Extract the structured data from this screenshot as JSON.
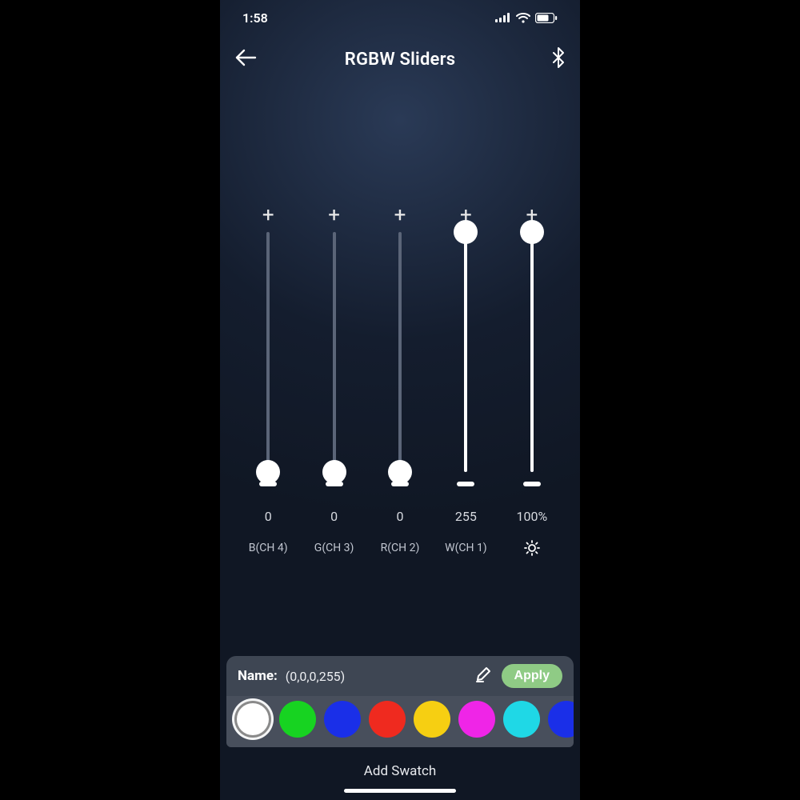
{
  "status": {
    "time": "1:58"
  },
  "header": {
    "title": "RGBW Sliders"
  },
  "sliders": [
    {
      "value": "0",
      "label": "B(CH 4)",
      "max": 255,
      "num": 0,
      "kind": "channel"
    },
    {
      "value": "0",
      "label": "G(CH 3)",
      "max": 255,
      "num": 0,
      "kind": "channel"
    },
    {
      "value": "0",
      "label": "R(CH 2)",
      "max": 255,
      "num": 0,
      "kind": "channel"
    },
    {
      "value": "255",
      "label": "W(CH 1)",
      "max": 255,
      "num": 255,
      "kind": "channel"
    },
    {
      "value": "100%",
      "label": "",
      "max": 100,
      "num": 100,
      "kind": "brightness"
    }
  ],
  "panel": {
    "name_label": "Name:",
    "name_value": "(0,0,0,255)",
    "apply_label": "Apply",
    "add_swatch_label": "Add Swatch"
  },
  "swatches": [
    {
      "color": "#ffffff",
      "selected": true
    },
    {
      "color": "#17d321",
      "selected": false
    },
    {
      "color": "#1a2fe8",
      "selected": false
    },
    {
      "color": "#ef2a1f",
      "selected": false
    },
    {
      "color": "#f6cf12",
      "selected": false
    },
    {
      "color": "#ef25e7",
      "selected": false
    },
    {
      "color": "#1fd8e6",
      "selected": false
    },
    {
      "color": "#1a2fe8",
      "selected": false
    }
  ]
}
